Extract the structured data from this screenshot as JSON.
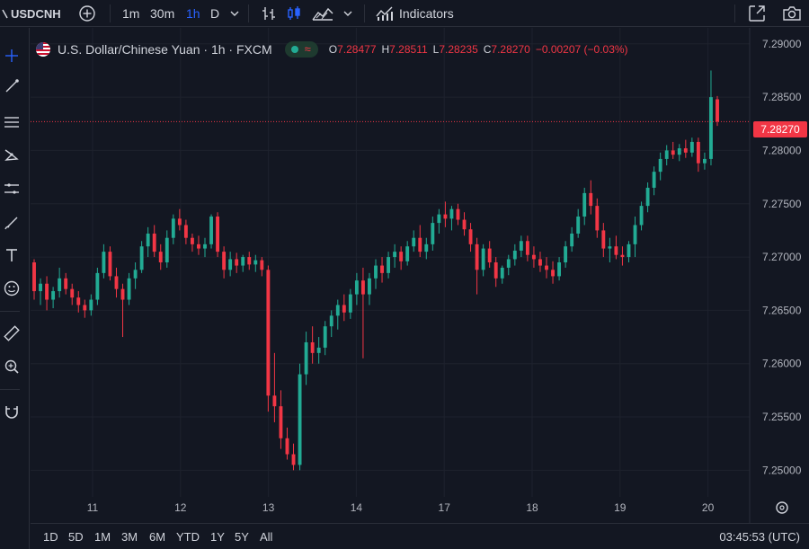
{
  "toolbar": {
    "symbol": "USDCNH",
    "intervals": [
      "1m",
      "30m",
      "1h",
      "D"
    ],
    "active_interval": "1h",
    "indicators_label": "Indicators"
  },
  "legend": {
    "title": "U.S. Dollar/Chinese Yuan · 1h · FXCM",
    "open_key": "O",
    "open": "7.28477",
    "high_key": "H",
    "high": "7.28511",
    "low_key": "L",
    "low": "7.28235",
    "close_key": "C",
    "close": "7.28270",
    "change": "−0.00207 (−0.03%)"
  },
  "price_axis": {
    "ticks": [
      "7.29000",
      "7.28500",
      "7.28000",
      "7.27500",
      "7.27000",
      "7.26500",
      "7.26000",
      "7.25500",
      "7.25000"
    ],
    "current_price": "7.28270"
  },
  "time_axis": {
    "labels": [
      "11",
      "12",
      "13",
      "14",
      "17",
      "18",
      "19",
      "20"
    ]
  },
  "ranges": [
    "1D",
    "5D",
    "1M",
    "3M",
    "6M",
    "YTD",
    "1Y",
    "5Y",
    "All"
  ],
  "clock": "03:45:53 (UTC)",
  "colors": {
    "up": "#22ab94",
    "down": "#f23645",
    "background": "#131722",
    "grid": "#1e222d",
    "accent": "#2962ff"
  },
  "icons": {
    "left": [
      "crosshair-icon",
      "trend-line-icon",
      "fib-icon",
      "pattern-icon",
      "forecast-icon",
      "brush-icon",
      "text-icon",
      "emoji-icon",
      "ruler-icon",
      "zoom-icon",
      "magnet-icon"
    ]
  },
  "chart_data": {
    "type": "candlestick",
    "symbol": "USDCNH",
    "interval": "1h",
    "ylim": [
      7.2475,
      7.2915
    ],
    "x_labels": [
      "11",
      "12",
      "13",
      "14",
      "17",
      "18",
      "19",
      "20"
    ],
    "candles": [
      [
        7.2695,
        7.2698,
        7.266,
        7.2668
      ],
      [
        7.2668,
        7.268,
        7.2655,
        7.2675
      ],
      [
        7.2675,
        7.2682,
        7.265,
        7.266
      ],
      [
        7.266,
        7.2672,
        7.2652,
        7.2668
      ],
      [
        7.2668,
        7.269,
        7.2662,
        7.268
      ],
      [
        7.268,
        7.2685,
        7.2665,
        7.267
      ],
      [
        7.267,
        7.2675,
        7.2655,
        7.2662
      ],
      [
        7.2662,
        7.2668,
        7.2648,
        7.2655
      ],
      [
        7.2655,
        7.266,
        7.2643,
        7.265
      ],
      [
        7.265,
        7.2665,
        7.2645,
        7.266
      ],
      [
        7.266,
        7.269,
        7.2655,
        7.2685
      ],
      [
        7.2685,
        7.2712,
        7.268,
        7.2705
      ],
      [
        7.2705,
        7.271,
        7.2678,
        7.2682
      ],
      [
        7.2682,
        7.269,
        7.2662,
        7.267
      ],
      [
        7.267,
        7.2675,
        7.2625,
        7.266
      ],
      [
        7.266,
        7.2685,
        7.2655,
        7.268
      ],
      [
        7.268,
        7.2695,
        7.267,
        7.2688
      ],
      [
        7.2688,
        7.2715,
        7.2685,
        7.271
      ],
      [
        7.271,
        7.2728,
        7.27,
        7.2722
      ],
      [
        7.2722,
        7.273,
        7.27,
        7.2705
      ],
      [
        7.2705,
        7.2712,
        7.2688,
        7.2695
      ],
      [
        7.2695,
        7.2725,
        7.269,
        7.2718
      ],
      [
        7.2718,
        7.274,
        7.2712,
        7.2736
      ],
      [
        7.2736,
        7.2745,
        7.2725,
        7.273
      ],
      [
        7.273,
        7.2735,
        7.2712,
        7.2718
      ],
      [
        7.2718,
        7.2722,
        7.2705,
        7.2712
      ],
      [
        7.2712,
        7.272,
        7.2702,
        7.2708
      ],
      [
        7.2708,
        7.2718,
        7.27,
        7.2712
      ],
      [
        7.2712,
        7.274,
        7.2708,
        7.2738
      ],
      [
        7.2738,
        7.2742,
        7.27,
        7.2705
      ],
      [
        7.2705,
        7.271,
        7.268,
        7.2688
      ],
      [
        7.2688,
        7.2705,
        7.2682,
        7.2698
      ],
      [
        7.2698,
        7.2704,
        7.2685,
        7.2692
      ],
      [
        7.2692,
        7.2702,
        7.2686,
        7.27
      ],
      [
        7.27,
        7.2705,
        7.2688,
        7.2693
      ],
      [
        7.2693,
        7.2702,
        7.2686,
        7.2697
      ],
      [
        7.2697,
        7.27,
        7.2682,
        7.2688
      ],
      [
        7.2688,
        7.2692,
        7.2555,
        7.257
      ],
      [
        7.257,
        7.261,
        7.2545,
        7.256
      ],
      [
        7.256,
        7.2575,
        7.252,
        7.253
      ],
      [
        7.253,
        7.254,
        7.251,
        7.2515
      ],
      [
        7.2515,
        7.2525,
        7.25,
        7.2505
      ],
      [
        7.2505,
        7.26,
        7.25,
        7.259
      ],
      [
        7.259,
        7.263,
        7.258,
        7.262
      ],
      [
        7.262,
        7.2635,
        7.26,
        7.261
      ],
      [
        7.261,
        7.2625,
        7.26,
        7.2615
      ],
      [
        7.2615,
        7.264,
        7.2608,
        7.2635
      ],
      [
        7.2635,
        7.265,
        7.2625,
        7.2645
      ],
      [
        7.2645,
        7.266,
        7.2632,
        7.2655
      ],
      [
        7.2655,
        7.2665,
        7.264,
        7.2648
      ],
      [
        7.2648,
        7.267,
        7.2642,
        7.2665
      ],
      [
        7.2665,
        7.2685,
        7.2655,
        7.2678
      ],
      [
        7.2678,
        7.269,
        7.2605,
        7.2665
      ],
      [
        7.2665,
        7.2685,
        7.2655,
        7.268
      ],
      [
        7.268,
        7.2698,
        7.267,
        7.2692
      ],
      [
        7.2692,
        7.27,
        7.2676,
        7.2685
      ],
      [
        7.2685,
        7.2705,
        7.268,
        7.27
      ],
      [
        7.27,
        7.2712,
        7.269,
        7.2705
      ],
      [
        7.2705,
        7.271,
        7.2688,
        7.2696
      ],
      [
        7.2696,
        7.2715,
        7.2692,
        7.271
      ],
      [
        7.271,
        7.2725,
        7.2705,
        7.2718
      ],
      [
        7.2718,
        7.273,
        7.27,
        7.2705
      ],
      [
        7.2705,
        7.2718,
        7.2698,
        7.2712
      ],
      [
        7.2712,
        7.2738,
        7.2706,
        7.2732
      ],
      [
        7.2732,
        7.2745,
        7.2722,
        7.274
      ],
      [
        7.274,
        7.2752,
        7.2728,
        7.2736
      ],
      [
        7.2736,
        7.2748,
        7.2725,
        7.2745
      ],
      [
        7.2745,
        7.275,
        7.273,
        7.2735
      ],
      [
        7.2735,
        7.2742,
        7.272,
        7.2726
      ],
      [
        7.2726,
        7.2732,
        7.2705,
        7.2712
      ],
      [
        7.2712,
        7.2718,
        7.2665,
        7.2688
      ],
      [
        7.2688,
        7.2712,
        7.2682,
        7.2708
      ],
      [
        7.2708,
        7.2715,
        7.269,
        7.2695
      ],
      [
        7.2695,
        7.27,
        7.2672,
        7.268
      ],
      [
        7.268,
        7.2692,
        7.2675,
        7.269
      ],
      [
        7.269,
        7.2702,
        7.2683,
        7.2698
      ],
      [
        7.2698,
        7.2712,
        7.2692,
        7.2706
      ],
      [
        7.2706,
        7.272,
        7.27,
        7.2715
      ],
      [
        7.2715,
        7.272,
        7.2696,
        7.2702
      ],
      [
        7.2702,
        7.271,
        7.269,
        7.2698
      ],
      [
        7.2698,
        7.2705,
        7.2686,
        7.2692
      ],
      [
        7.2692,
        7.27,
        7.268,
        7.2688
      ],
      [
        7.2688,
        7.2696,
        7.2675,
        7.2682
      ],
      [
        7.2682,
        7.27,
        7.2678,
        7.2695
      ],
      [
        7.2695,
        7.2715,
        7.269,
        7.271
      ],
      [
        7.271,
        7.2728,
        7.2705,
        7.2722
      ],
      [
        7.2722,
        7.2745,
        7.2718,
        7.2738
      ],
      [
        7.2738,
        7.2765,
        7.273,
        7.276
      ],
      [
        7.276,
        7.2772,
        7.274,
        7.2748
      ],
      [
        7.2748,
        7.2755,
        7.2718,
        7.2725
      ],
      [
        7.2725,
        7.2732,
        7.27,
        7.2708
      ],
      [
        7.2708,
        7.2718,
        7.2695,
        7.271
      ],
      [
        7.271,
        7.272,
        7.2698,
        7.2702
      ],
      [
        7.2702,
        7.271,
        7.2692,
        7.27
      ],
      [
        7.27,
        7.2715,
        7.2695,
        7.2712
      ],
      [
        7.2712,
        7.2738,
        7.27,
        7.273
      ],
      [
        7.273,
        7.2752,
        7.2725,
        7.2748
      ],
      [
        7.2748,
        7.277,
        7.2742,
        7.2765
      ],
      [
        7.2765,
        7.2785,
        7.2758,
        7.278
      ],
      [
        7.278,
        7.2798,
        7.2772,
        7.2792
      ],
      [
        7.2792,
        7.2805,
        7.2786,
        7.28
      ],
      [
        7.28,
        7.2808,
        7.2792,
        7.2796
      ],
      [
        7.2796,
        7.2806,
        7.279,
        7.2802
      ],
      [
        7.2802,
        7.281,
        7.2793,
        7.2798
      ],
      [
        7.2798,
        7.2812,
        7.2794,
        7.2808
      ],
      [
        7.2808,
        7.2812,
        7.278,
        7.2788
      ],
      [
        7.2788,
        7.2798,
        7.2782,
        7.2792
      ],
      [
        7.2792,
        7.2875,
        7.2786,
        7.285
      ],
      [
        7.2848,
        7.2851,
        7.2823,
        7.2827
      ]
    ]
  }
}
